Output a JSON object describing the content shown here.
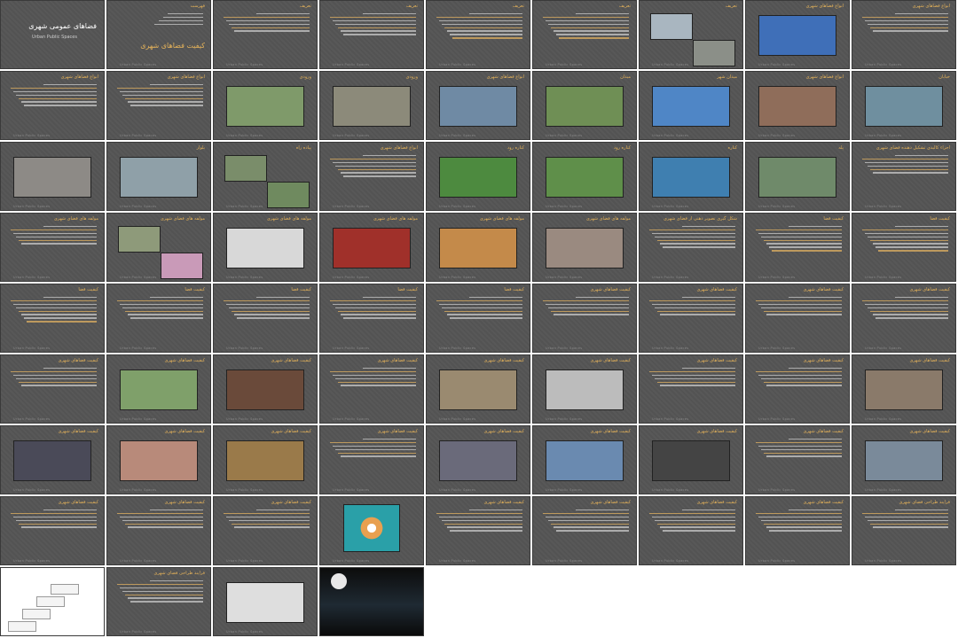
{
  "footer_text": "Urban Public Spaces",
  "slides": [
    {
      "row": 0,
      "col": 0,
      "kind": "cover",
      "title": "فضاهای عمومی شهری",
      "subtitle": "Urban Public Spaces"
    },
    {
      "row": 0,
      "col": 1,
      "kind": "toc",
      "title": "فهرست",
      "big_text": "کیفیت فضاهای شهری"
    },
    {
      "row": 0,
      "col": 2,
      "kind": "text",
      "title": "تعریف",
      "lines": 6
    },
    {
      "row": 0,
      "col": 3,
      "kind": "text",
      "title": "تعریف",
      "lines": 7
    },
    {
      "row": 0,
      "col": 4,
      "kind": "text",
      "title": "تعریف",
      "lines": 8
    },
    {
      "row": 0,
      "col": 5,
      "kind": "text",
      "title": "تعریف",
      "lines": 8
    },
    {
      "row": 0,
      "col": 6,
      "kind": "photos",
      "title": "تعریف",
      "photos": [
        {
          "c": "#a9b6c0"
        },
        {
          "c": "#8b8f88"
        }
      ]
    },
    {
      "row": 0,
      "col": 7,
      "kind": "photo",
      "title": "انواع فضاهای شهری",
      "photo_color": "#3f6fb8"
    },
    {
      "row": 0,
      "col": 8,
      "kind": "text",
      "title": "انواع فضاهای شهری",
      "lines": 6
    },
    {
      "row": 1,
      "col": 0,
      "kind": "text",
      "title": "انواع فضاهای شهری",
      "lines": 7
    },
    {
      "row": 1,
      "col": 1,
      "kind": "text",
      "title": "انواع فضاهای شهری",
      "lines": 7
    },
    {
      "row": 1,
      "col": 2,
      "kind": "photo",
      "title": "ورودی",
      "photo_color": "#7f9a6a"
    },
    {
      "row": 1,
      "col": 3,
      "kind": "photo",
      "title": "ورودی",
      "photo_color": "#8c8a7a"
    },
    {
      "row": 1,
      "col": 4,
      "kind": "photo",
      "title": "انواع فضاهای شهری",
      "photo_color": "#6f8aa4"
    },
    {
      "row": 1,
      "col": 5,
      "kind": "photo",
      "title": "میدان",
      "photo_color": "#6f8f55"
    },
    {
      "row": 1,
      "col": 6,
      "kind": "photo",
      "title": "میدان شهر",
      "photo_color": "#4f86c6"
    },
    {
      "row": 1,
      "col": 7,
      "kind": "photo",
      "title": "انواع فضاهای شهری",
      "photo_color": "#8f6d5a"
    },
    {
      "row": 1,
      "col": 8,
      "kind": "photo",
      "title": "خیابان",
      "photo_color": "#6f8f9f"
    },
    {
      "row": 2,
      "col": 0,
      "kind": "photo",
      "title": "",
      "photo_color": "#8d8a86"
    },
    {
      "row": 2,
      "col": 1,
      "kind": "photo",
      "title": "بلوار",
      "photo_color": "#8fa0a8"
    },
    {
      "row": 2,
      "col": 2,
      "kind": "photos",
      "title": "پیاده راه",
      "photos": [
        {
          "c": "#7a8d6a"
        },
        {
          "c": "#6f8a5f"
        }
      ]
    },
    {
      "row": 2,
      "col": 3,
      "kind": "text",
      "title": "انواع فضاهای شهری",
      "lines": 7
    },
    {
      "row": 2,
      "col": 4,
      "kind": "photo",
      "title": "کناره رود",
      "photo_color": "#4d8a3f"
    },
    {
      "row": 2,
      "col": 5,
      "kind": "photo",
      "title": "کناره رود",
      "photo_color": "#5f8f4a"
    },
    {
      "row": 2,
      "col": 6,
      "kind": "photo",
      "title": "کناره",
      "photo_color": "#3f7fb0"
    },
    {
      "row": 2,
      "col": 7,
      "kind": "photo",
      "title": "پله",
      "photo_color": "#6f8a6a"
    },
    {
      "row": 2,
      "col": 8,
      "kind": "text",
      "title": "اجزاء کالبدی تشکیل دهنده فضای شهری",
      "lines": 6
    },
    {
      "row": 3,
      "col": 0,
      "kind": "text",
      "title": "مولفه های فضای شهری",
      "lines": 6
    },
    {
      "row": 3,
      "col": 1,
      "kind": "photos",
      "title": "مولفه های فضای شهری",
      "photos": [
        {
          "c": "#8e9a7a"
        },
        {
          "c": "#c99ab8"
        }
      ]
    },
    {
      "row": 3,
      "col": 2,
      "kind": "photo",
      "title": "مولفه های فضای شهری",
      "photo_color": "#d8d8d8"
    },
    {
      "row": 3,
      "col": 3,
      "kind": "photo",
      "title": "مولفه های فضای شهری",
      "photo_color": "#a0302a"
    },
    {
      "row": 3,
      "col": 4,
      "kind": "photo",
      "title": "مولفه های فضای شهری",
      "photo_color": "#c48a4a"
    },
    {
      "row": 3,
      "col": 5,
      "kind": "photo",
      "title": "مولفه های فضای شهری",
      "photo_color": "#9a8a80"
    },
    {
      "row": 3,
      "col": 6,
      "kind": "text",
      "title": "شکل گیری تصویر ذهنی از فضای شهری",
      "lines": 7
    },
    {
      "row": 3,
      "col": 7,
      "kind": "text",
      "title": "کیفیت فضا",
      "lines": 8
    },
    {
      "row": 3,
      "col": 8,
      "kind": "text",
      "title": "کیفیت فضا",
      "lines": 8
    },
    {
      "row": 4,
      "col": 0,
      "kind": "text",
      "title": "کیفیت فضا",
      "lines": 8
    },
    {
      "row": 4,
      "col": 1,
      "kind": "text",
      "title": "کیفیت فضا",
      "lines": 7
    },
    {
      "row": 4,
      "col": 2,
      "kind": "text",
      "title": "کیفیت فضا",
      "lines": 7
    },
    {
      "row": 4,
      "col": 3,
      "kind": "text",
      "title": "کیفیت فضا",
      "lines": 7
    },
    {
      "row": 4,
      "col": 4,
      "kind": "text",
      "title": "کیفیت فضا",
      "lines": 7
    },
    {
      "row": 4,
      "col": 5,
      "kind": "text",
      "title": "کیفیت فضاهای شهری",
      "lines": 6
    },
    {
      "row": 4,
      "col": 6,
      "kind": "text",
      "title": "کیفیت فضاهای شهری",
      "lines": 6
    },
    {
      "row": 4,
      "col": 7,
      "kind": "text",
      "title": "کیفیت فضاهای شهری",
      "lines": 6
    },
    {
      "row": 4,
      "col": 8,
      "kind": "text",
      "title": "کیفیت فضاهای شهری",
      "lines": 7
    },
    {
      "row": 5,
      "col": 0,
      "kind": "text",
      "title": "کیفیت فضاهای شهری",
      "lines": 6
    },
    {
      "row": 5,
      "col": 1,
      "kind": "photo",
      "title": "کیفیت فضاهای شهری",
      "photo_color": "#7fa06a"
    },
    {
      "row": 5,
      "col": 2,
      "kind": "photo",
      "title": "کیفیت فضاهای شهری",
      "photo_color": "#6a4a3a"
    },
    {
      "row": 5,
      "col": 3,
      "kind": "text",
      "title": "کیفیت فضاهای شهری",
      "lines": 6
    },
    {
      "row": 5,
      "col": 4,
      "kind": "photo",
      "title": "کیفیت فضاهای شهری",
      "photo_color": "#9a8a70"
    },
    {
      "row": 5,
      "col": 5,
      "kind": "photo",
      "title": "کیفیت فضاهای شهری",
      "photo_color": "#bcbcbc"
    },
    {
      "row": 5,
      "col": 6,
      "kind": "text",
      "title": "کیفیت فضاهای شهری",
      "lines": 6
    },
    {
      "row": 5,
      "col": 7,
      "kind": "text",
      "title": "کیفیت فضاهای شهری",
      "lines": 6
    },
    {
      "row": 5,
      "col": 8,
      "kind": "photo",
      "title": "کیفیت فضاهای شهری",
      "photo_color": "#8a7a6a"
    },
    {
      "row": 6,
      "col": 0,
      "kind": "photo",
      "title": "کیفیت فضاهای شهری",
      "photo_color": "#4a4a58"
    },
    {
      "row": 6,
      "col": 1,
      "kind": "photo",
      "title": "کیفیت فضاهای شهری",
      "photo_color": "#b88a7a"
    },
    {
      "row": 6,
      "col": 2,
      "kind": "photo",
      "title": "کیفیت فضاهای شهری",
      "photo_color": "#9a7a4a"
    },
    {
      "row": 6,
      "col": 3,
      "kind": "text",
      "title": "کیفیت فضاهای شهری",
      "lines": 6
    },
    {
      "row": 6,
      "col": 4,
      "kind": "photo",
      "title": "کیفیت فضاهای شهری",
      "photo_color": "#6a6a7a"
    },
    {
      "row": 6,
      "col": 5,
      "kind": "photo",
      "title": "کیفیت فضاهای شهری",
      "photo_color": "#6a8ab0"
    },
    {
      "row": 6,
      "col": 6,
      "kind": "photo",
      "title": "کیفیت فضاهای شهری",
      "photo_color": "#444444"
    },
    {
      "row": 6,
      "col": 7,
      "kind": "text",
      "title": "کیفیت فضاهای شهری",
      "lines": 6
    },
    {
      "row": 6,
      "col": 8,
      "kind": "photo",
      "title": "کیفیت فضاهای شهری",
      "photo_color": "#7a8a9a"
    },
    {
      "row": 7,
      "col": 0,
      "kind": "text",
      "title": "کیفیت فضاهای شهری",
      "lines": 6
    },
    {
      "row": 7,
      "col": 1,
      "kind": "text",
      "title": "کیفیت فضاهای شهری",
      "lines": 6
    },
    {
      "row": 7,
      "col": 2,
      "kind": "text",
      "title": "کیفیت فضاهای شهری",
      "lines": 6
    },
    {
      "row": 7,
      "col": 3,
      "kind": "diagram",
      "title": "",
      "photo_color": "#2aa0a8"
    },
    {
      "row": 7,
      "col": 4,
      "kind": "text",
      "title": "کیفیت فضاهای شهری",
      "lines": 7
    },
    {
      "row": 7,
      "col": 5,
      "kind": "text",
      "title": "کیفیت فضاهای شهری",
      "lines": 7
    },
    {
      "row": 7,
      "col": 6,
      "kind": "text",
      "title": "کیفیت فضاهای شهری",
      "lines": 7
    },
    {
      "row": 7,
      "col": 7,
      "kind": "text",
      "title": "کیفیت فضاهای شهری",
      "lines": 7
    },
    {
      "row": 7,
      "col": 8,
      "kind": "text",
      "title": "فرایند طراحی فضای شهری",
      "lines": 6
    },
    {
      "row": 8,
      "col": 0,
      "kind": "steps",
      "title": ""
    },
    {
      "row": 8,
      "col": 1,
      "kind": "text",
      "title": "فرایند طراحی فضای شهری",
      "lines": 7
    },
    {
      "row": 8,
      "col": 2,
      "kind": "photo",
      "title": "",
      "photo_color": "#dedede"
    },
    {
      "row": 8,
      "col": 3,
      "kind": "coverb",
      "title": "",
      "photo_color": "#202020"
    }
  ]
}
